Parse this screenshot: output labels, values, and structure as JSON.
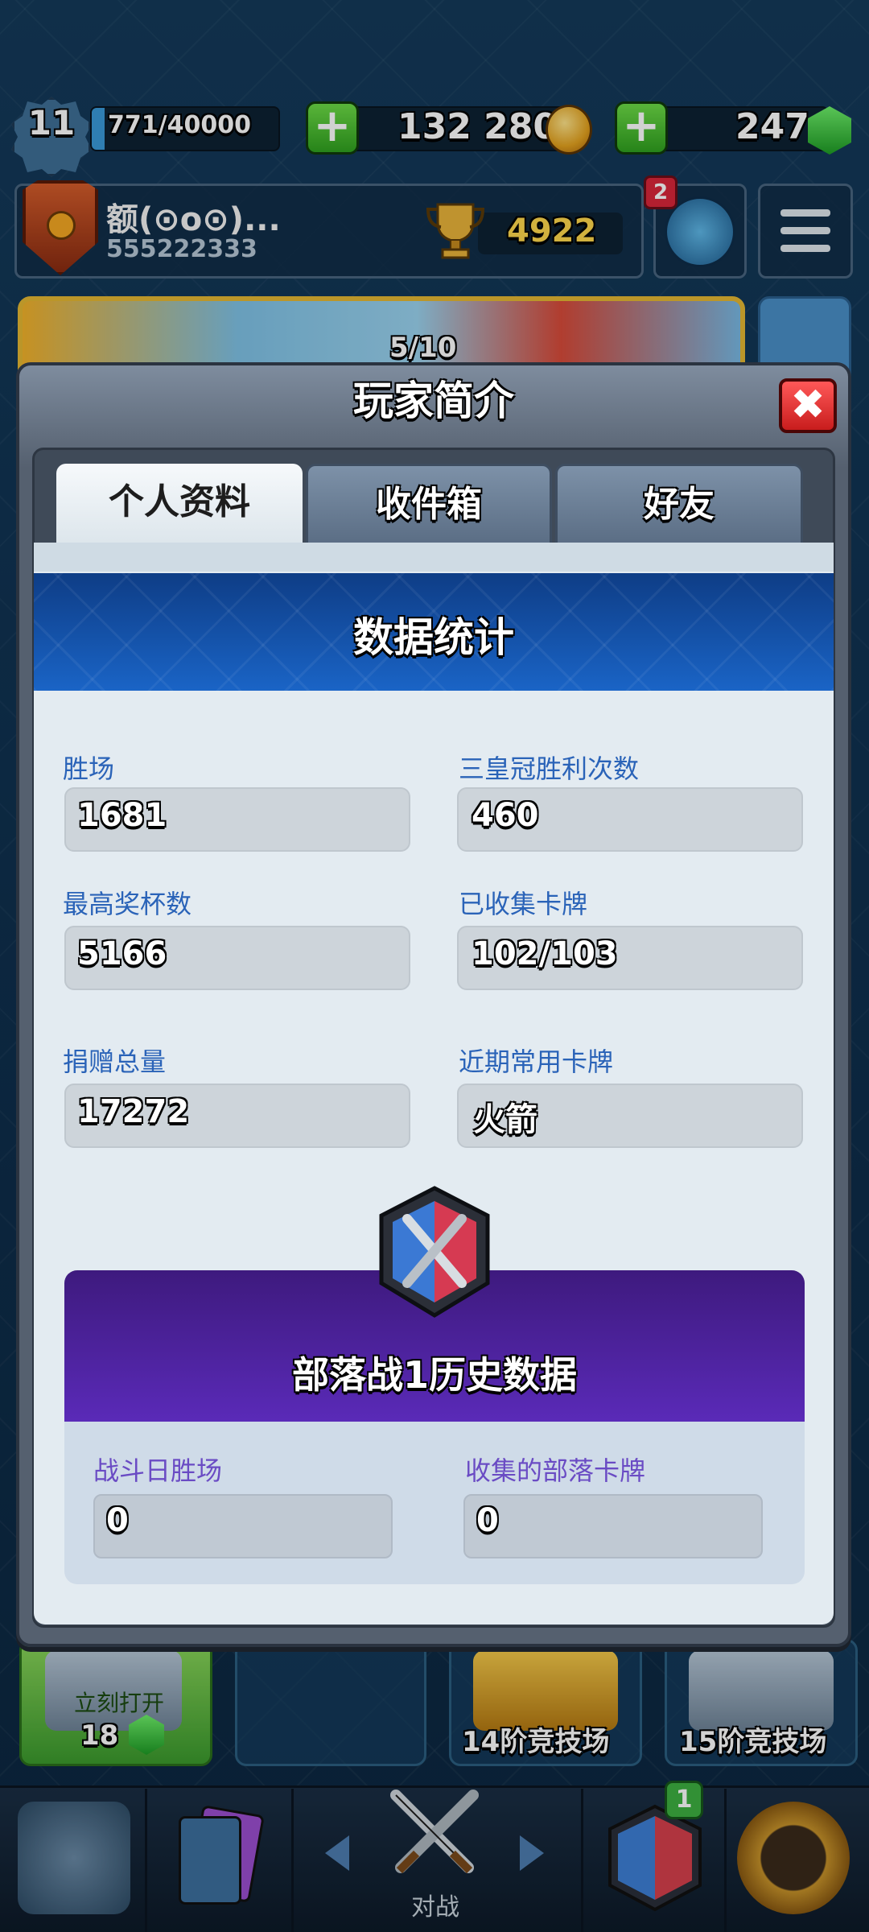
{
  "topbar": {
    "level": "11",
    "xp": "771/40000",
    "gold": "132 280",
    "gems": "247"
  },
  "profile": {
    "name": "额(⊙o⊙)...",
    "tag": "555222333",
    "trophies": "4922",
    "friend_badge": "2"
  },
  "background": {
    "banner_progress": "5/10",
    "chest_slots": [
      {
        "state": "立刻打开",
        "cost": "18"
      },
      {
        "label": "14阶竞技场"
      },
      {
        "label": "15阶竞技场"
      }
    ]
  },
  "nav": {
    "battle_label": "对战",
    "clan_badge": "1"
  },
  "modal": {
    "title": "玩家简介",
    "tabs": [
      "个人资料",
      "收件箱",
      "好友"
    ],
    "stats_title": "数据统计",
    "stats": [
      {
        "label": "胜场",
        "value": "1681"
      },
      {
        "label": "三皇冠胜利次数",
        "value": "460"
      },
      {
        "label": "最高奖杯数",
        "value": "5166"
      },
      {
        "label": "已收集卡牌",
        "value": "102/103"
      },
      {
        "label": "捐赠总量",
        "value": "17272"
      },
      {
        "label": "近期常用卡牌",
        "value": "火箭"
      }
    ],
    "clan_war": {
      "title": "部落战1历史数据",
      "stats": [
        {
          "label": "战斗日胜场",
          "value": "0"
        },
        {
          "label": "收集的部落卡牌",
          "value": "0"
        }
      ]
    }
  },
  "colors": {
    "accent_blue": "#2a63b8",
    "clan_war_purple": "#5a2ab8",
    "close_red": "#c81d1d",
    "trophy_gold": "#ffd84c"
  }
}
